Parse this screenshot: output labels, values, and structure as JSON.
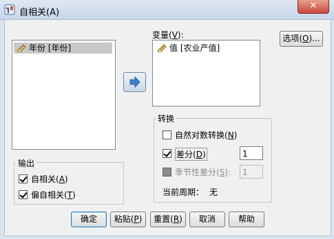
{
  "window": {
    "title": "自相关(A)",
    "close_symbol": "✕"
  },
  "source_list": {
    "items": [
      {
        "label": "年份 [年份]",
        "selected": true
      }
    ]
  },
  "variables": {
    "label_text": "变量(",
    "label_key": "V",
    "label_end": "):",
    "items": [
      {
        "label": "值 [农业产值]"
      }
    ]
  },
  "options_button": {
    "text": "选项(",
    "key": "O",
    "end": ")..."
  },
  "transform": {
    "title": "转换",
    "natural_log": {
      "text": "自然对数转换(",
      "key": "N",
      "end": ")",
      "checked": false
    },
    "difference": {
      "text": "差分(",
      "key": "D",
      "end": ")",
      "checked": true,
      "value": "1"
    },
    "seasonal_difference": {
      "text": "季节性差分(",
      "key": "S",
      "end": "):",
      "checked": false,
      "disabled": true,
      "value": "1"
    },
    "current_period_label": "当前周期：",
    "current_period_value": "无"
  },
  "output": {
    "title": "输出",
    "autocorrelation": {
      "text": "自相关(",
      "key": "A",
      "end": ")",
      "checked": true
    },
    "partial_autocorrelation": {
      "text": "偏自相关(",
      "key": "T",
      "end": ")",
      "checked": true
    }
  },
  "buttons": {
    "ok": "确定",
    "paste": {
      "text": "粘贴(",
      "key": "P",
      "end": ")"
    },
    "reset": {
      "text": "重置(",
      "key": "R",
      "end": ")"
    },
    "cancel": "取消",
    "help": "帮助"
  },
  "colors": {
    "arrow": "#3d7fc7",
    "default_button_border": "#3c7fb1",
    "close_button": "#c9483a"
  }
}
